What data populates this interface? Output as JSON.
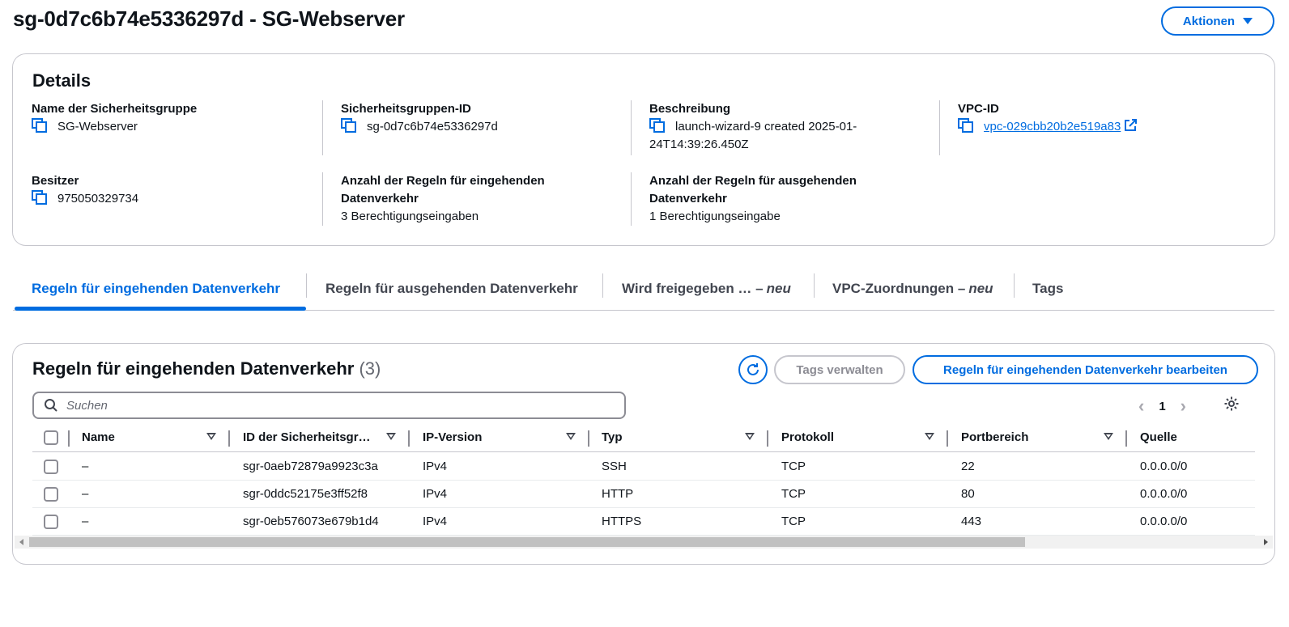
{
  "header": {
    "title": "sg-0d7c6b74e5336297d - SG-Webserver",
    "actions_label": "Aktionen"
  },
  "details": {
    "title": "Details",
    "group_name_label": "Name der Sicherheitsgruppe",
    "group_name_value": "SG-Webserver",
    "group_id_label": "Sicherheitsgruppen-ID",
    "group_id_value": "sg-0d7c6b74e5336297d",
    "description_label": "Beschreibung",
    "description_value_line1": "launch-wizard-9 created 2025-01-",
    "description_value_line2": "24T14:39:26.450Z",
    "vpc_label": "VPC-ID",
    "vpc_value": "vpc-029cbb20b2e519a83",
    "owner_label": "Besitzer",
    "owner_value": "975050329734",
    "inbound_count_label_line1": "Anzahl der Regeln für eingehenden",
    "inbound_count_label_line2": "Datenverkehr",
    "inbound_count_value": "3 Berechtigungseingaben",
    "outbound_count_label_line1": "Anzahl der Regeln für ausgehenden",
    "outbound_count_label_line2": "Datenverkehr",
    "outbound_count_value": "1 Berechtigungseingabe"
  },
  "tabs": [
    {
      "label": "Regeln für eingehenden Datenverkehr",
      "badge": ""
    },
    {
      "label": "Regeln für ausgehenden Datenverkehr",
      "badge": ""
    },
    {
      "label": "Wird freigegeben … –",
      "badge": "neu"
    },
    {
      "label": "VPC-Zuordnungen –",
      "badge": "neu"
    },
    {
      "label": "Tags",
      "badge": ""
    }
  ],
  "rules": {
    "title": "Regeln für eingehenden Datenverkehr",
    "count": "(3)",
    "manage_tags_label": "Tags verwalten",
    "edit_label": "Regeln für eingehenden Datenverkehr bearbeiten",
    "search_placeholder": "Suchen",
    "page_number": "1",
    "columns": [
      "Name",
      "ID der Sicherheitsgr…",
      "IP-Version",
      "Typ",
      "Protokoll",
      "Portbereich",
      "Quelle"
    ],
    "rows": [
      [
        "–",
        "sgr-0aeb72879a9923c3a",
        "IPv4",
        "SSH",
        "TCP",
        "22",
        "0.0.0.0/0"
      ],
      [
        "–",
        "sgr-0ddc52175e3ff52f8",
        "IPv4",
        "HTTP",
        "TCP",
        "80",
        "0.0.0.0/0"
      ],
      [
        "–",
        "sgr-0eb576073e679b1d4",
        "IPv4",
        "HTTPS",
        "TCP",
        "443",
        "0.0.0.0/0"
      ]
    ]
  },
  "colors": {
    "accent": "#006ce0",
    "text": "#0f141a",
    "border": "#c6c6cd"
  }
}
